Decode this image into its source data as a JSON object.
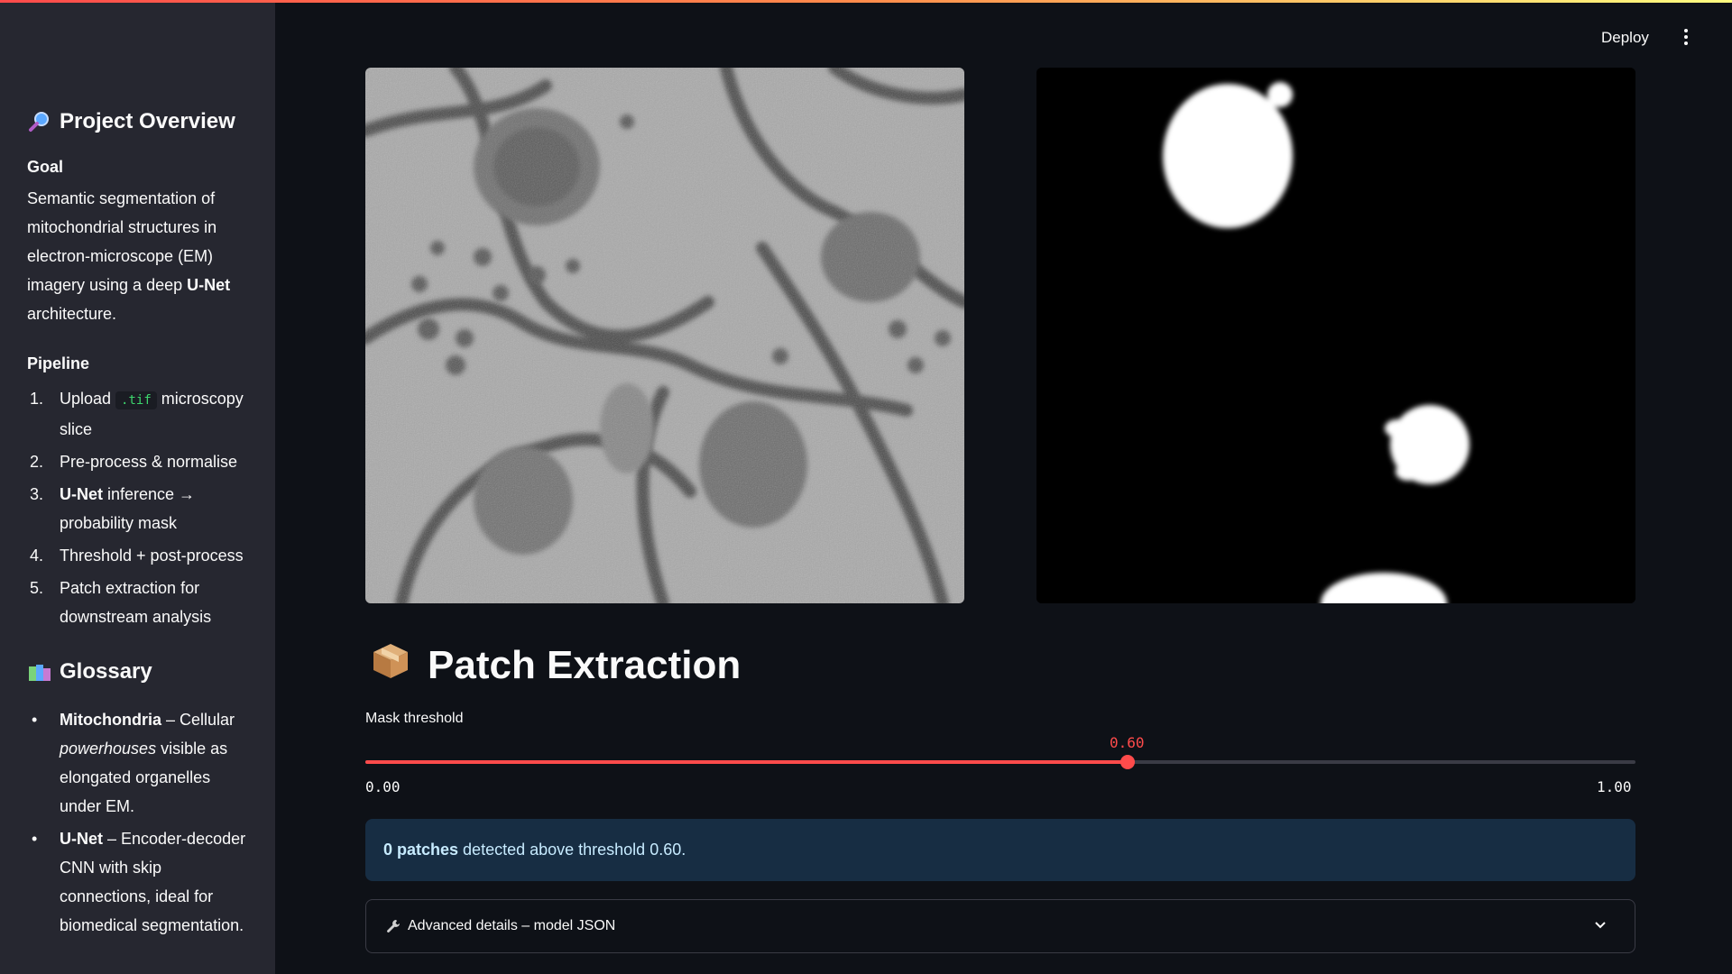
{
  "header": {
    "deploy_label": "Deploy"
  },
  "sidebar": {
    "overview_title": "Project Overview",
    "goal_label": "Goal",
    "goal_text_1": "Semantic segmentation of mitochondrial structures in electron-microscope (EM) imagery using a deep ",
    "goal_text_bold": "U-Net",
    "goal_text_2": " architecture.",
    "pipeline_label": "Pipeline",
    "pipeline": [
      {
        "num": "1.",
        "pre": "Upload ",
        "code": ".tif",
        "post": " microscopy slice"
      },
      {
        "num": "2.",
        "text": "Pre-process & normalise"
      },
      {
        "num": "3.",
        "bold": "U-Net",
        "text": " inference → probability mask"
      },
      {
        "num": "4.",
        "text": "Threshold + post-process"
      },
      {
        "num": "5.",
        "text": "Patch extraction for downstream analysis"
      }
    ],
    "glossary_title": "Glossary",
    "glossary": [
      {
        "term": "Mitochondria",
        "sep": " – Cellular ",
        "em": "powerhouses",
        "rest": " visible as elongated organelles under EM."
      },
      {
        "term": "U-Net",
        "sep": " – ",
        "rest": "Encoder-decoder CNN with skip connections, ideal for biomedical segmentation."
      }
    ]
  },
  "main": {
    "section_title": "Patch Extraction",
    "slider": {
      "label": "Mask threshold",
      "value": 0.6,
      "value_text": "0.60",
      "min_text": "0.00",
      "max_text": "1.00"
    },
    "info": {
      "count_bold": "0 patches",
      "rest": " detected above threshold 0.60."
    },
    "expander_label": "Advanced details – model JSON"
  },
  "icons": {
    "overview": "magnifier-icon",
    "glossary": "books-icon",
    "section": "package-icon",
    "expander": "wrench-icon",
    "chevron": "chevron-down-icon",
    "menu": "kebab-menu-icon"
  },
  "colors": {
    "accent": "#ff4b4b",
    "background": "#0e1117",
    "sidebar": "#262730",
    "info_bg": "#172d43",
    "info_text": "#c7ebff",
    "code": "#3dd56d"
  }
}
